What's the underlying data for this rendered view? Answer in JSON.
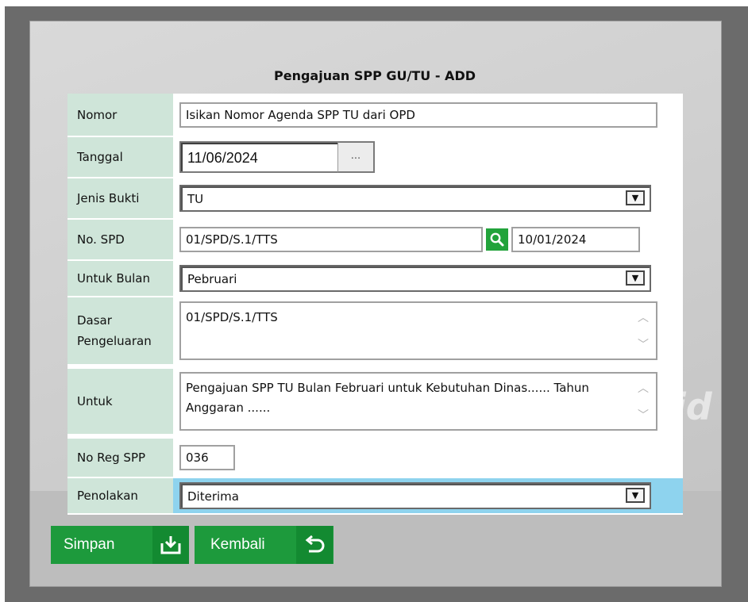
{
  "form": {
    "title": "Pengajuan SPP GU/TU - ADD"
  },
  "fields": {
    "nomor": {
      "label": "Nomor",
      "value": "Isikan Nomor Agenda SPP TU dari OPD"
    },
    "tanggal": {
      "label": "Tanggal",
      "value": "11/06/2024",
      "picker_label": "..."
    },
    "jenis_bukti": {
      "label": "Jenis Bukti",
      "selected": "TU"
    },
    "no_spd": {
      "label": "No. SPD",
      "value": "01/SPD/S.1/TTS",
      "date": "10/01/2024"
    },
    "untuk_bulan": {
      "label": "Untuk Bulan",
      "selected": "Pebruari"
    },
    "dasar_pengeluaran": {
      "label_line1": "Dasar",
      "label_line2": "Pengeluaran",
      "value": "01/SPD/S.1/TTS"
    },
    "untuk": {
      "label": "Untuk",
      "value": "Pengajuan SPP TU Bulan Februari untuk Kebutuhan Dinas...... Tahun Anggaran ......"
    },
    "no_reg_spp": {
      "label": "No Reg SPP",
      "value": "036"
    },
    "penolakan": {
      "label": "Penolakan",
      "selected": "Diterima"
    }
  },
  "buttons": {
    "simpan": "Simpan",
    "kembali": "Kembali"
  },
  "colors": {
    "label_bg": "#cfe5d9",
    "button_green": "#1d9a3c",
    "highlight_row": "#8ed3ee"
  }
}
